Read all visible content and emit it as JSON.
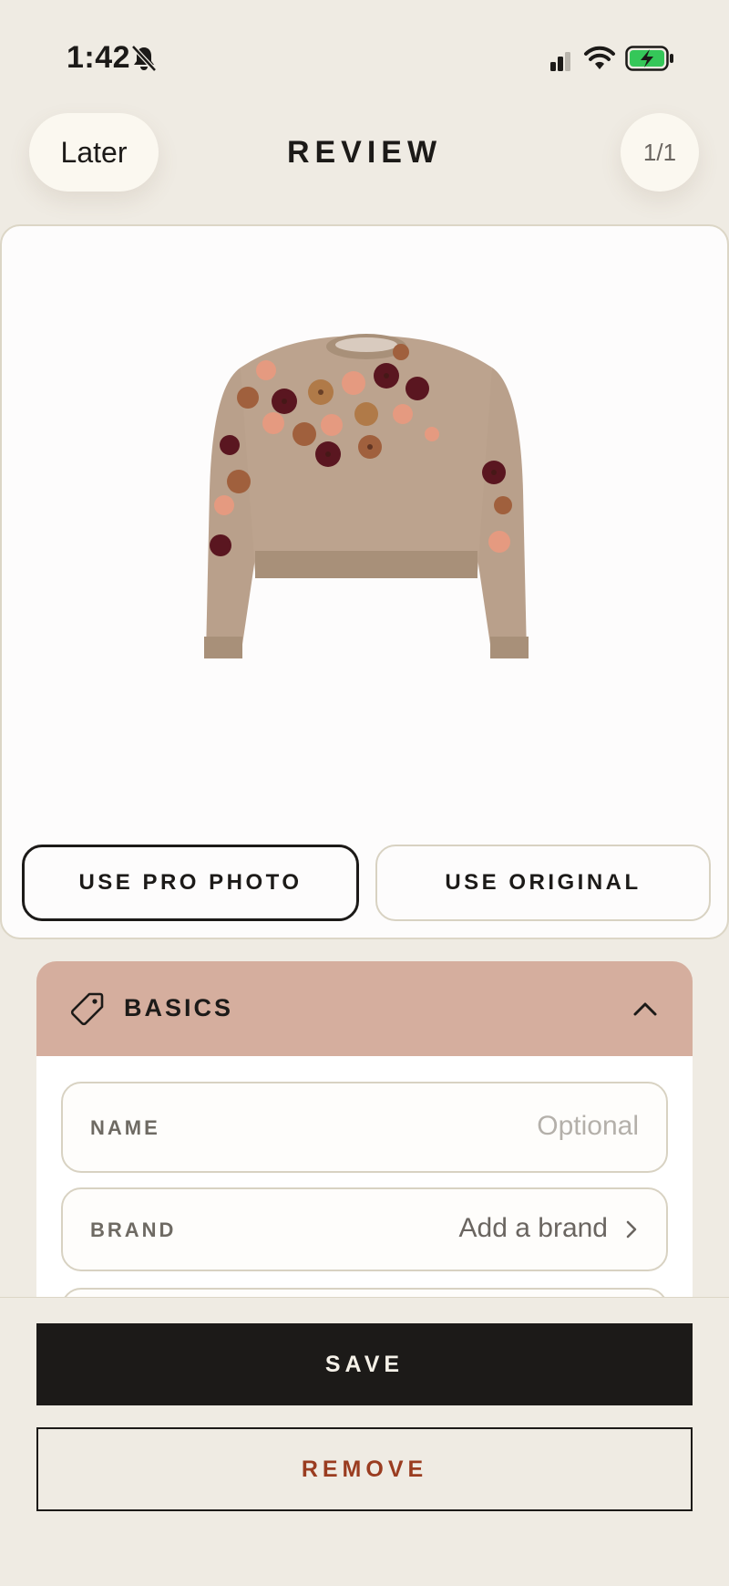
{
  "status_bar": {
    "time": "1:42",
    "icons": [
      "bell-slash-icon",
      "signal-icon",
      "wifi-icon",
      "battery-charging-icon"
    ]
  },
  "header": {
    "later_label": "Later",
    "title": "REVIEW",
    "counter": "1/1"
  },
  "photo": {
    "image": "knit-sweater-with-flowers",
    "use_pro_label": "USE PRO PHOTO",
    "use_original_label": "USE ORIGINAL",
    "selected": "pro"
  },
  "basics": {
    "title": "BASICS",
    "icon": "tag-icon",
    "expanded": true,
    "fields": [
      {
        "label": "NAME",
        "value": "Optional"
      },
      {
        "label": "BRAND",
        "value": "Add a brand"
      }
    ]
  },
  "actions": {
    "save_label": "SAVE",
    "remove_label": "REMOVE"
  },
  "colors": {
    "background": "#efebe3",
    "basics_header": "#d5ae9e",
    "remove_text": "#9a3c20",
    "save_bg": "#1c1a18"
  }
}
